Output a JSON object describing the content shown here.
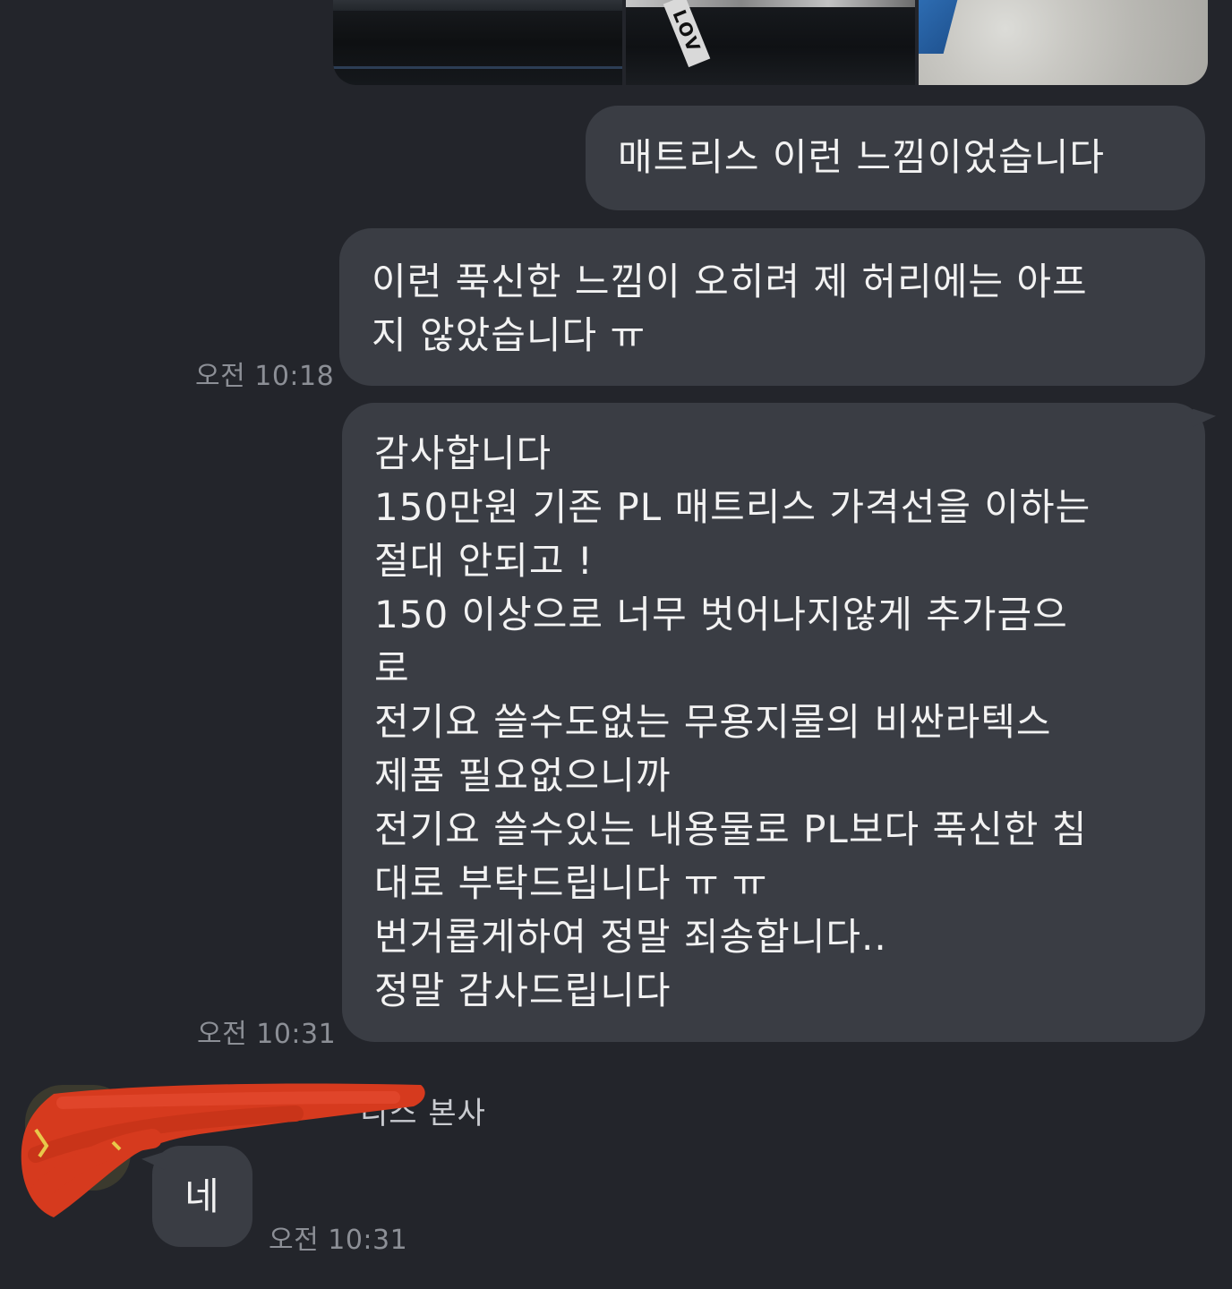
{
  "chat": {
    "photos": [
      {
        "name": "photo-dark-mattress"
      },
      {
        "name": "photo-mattress-label",
        "tag_text": "LOV"
      },
      {
        "name": "photo-quilted-mattress"
      }
    ],
    "messages": [
      {
        "side": "outgoing",
        "lines": [
          "매트리스 이런 느낌이었습니다"
        ]
      },
      {
        "side": "outgoing",
        "lines": [
          "이런 푹신한 느낌이 오히려 제 허리에는 아프",
          "지 않았습니다 ㅠ"
        ],
        "time": "오전 10:18"
      },
      {
        "side": "outgoing",
        "lines": [
          "감사합니다",
          "150만원 기존 PL 매트리스 가격선을 이하는",
          "절대 안되고 !",
          "150 이상으로 너무 벗어나지않게 추가금으",
          "로",
          "전기요 쓸수도없는 무용지물의 비싼라텍스",
          "제품 필요없으니까",
          "전기요 쓸수있는 내용물로 PL보다 푹신한 침",
          "대로 부탁드립니다 ㅠ ㅠ",
          "번거롭게하여 정말 죄송합니다..",
          "정말 감사드립니다"
        ],
        "time": "오전 10:31"
      },
      {
        "side": "incoming",
        "sender": "니스 본사",
        "lines": [
          "네"
        ],
        "time": "오전 10:31"
      }
    ]
  },
  "colors": {
    "background": "#23252b",
    "bubble": "#3a3d44",
    "text": "#f2f2f2",
    "timestamp": "#8c8f96",
    "redaction": "#d63a1e"
  }
}
